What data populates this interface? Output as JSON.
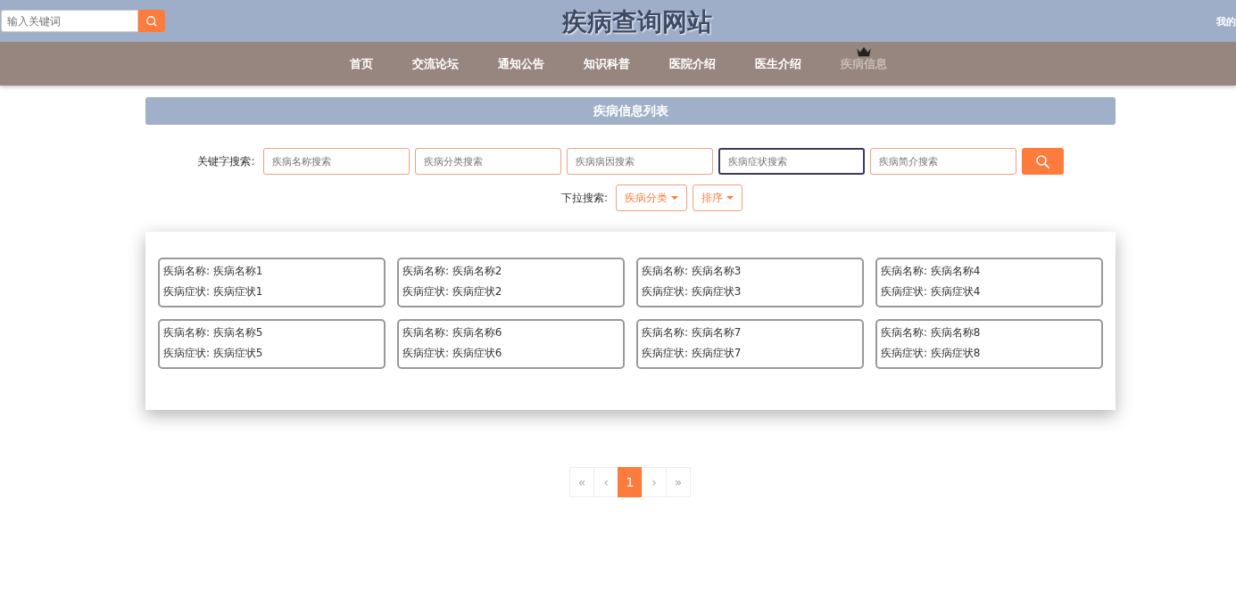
{
  "header": {
    "search": {
      "placeholder": "输入关键词"
    },
    "title": "疾病查询网站",
    "user_link": "我的"
  },
  "nav": [
    {
      "label": "首页",
      "selected": false
    },
    {
      "label": "交流论坛",
      "selected": false
    },
    {
      "label": "通知公告",
      "selected": false
    },
    {
      "label": "知识科普",
      "selected": false
    },
    {
      "label": "医院介绍",
      "selected": false
    },
    {
      "label": "医生介绍",
      "selected": false
    },
    {
      "label": "疾病信息",
      "selected": true
    }
  ],
  "section_title": "疾病信息列表",
  "keyword_search": {
    "label": "关键字搜索:",
    "fields": [
      {
        "placeholder": "疾病名称搜索",
        "focused": false
      },
      {
        "placeholder": "疾病分类搜索",
        "focused": false
      },
      {
        "placeholder": "疾病病因搜索",
        "focused": false
      },
      {
        "placeholder": "疾病症状搜索",
        "focused": true
      },
      {
        "placeholder": "疾病简介搜索",
        "focused": false
      }
    ]
  },
  "dropdown_search": {
    "label": "下拉搜索:",
    "dropdowns": [
      "疾病分类",
      "排序"
    ]
  },
  "cards": [
    {
      "lines": [
        "疾病名称: 疾病名称1",
        "疾病症状: 疾病症状1"
      ]
    },
    {
      "lines": [
        "疾病名称: 疾病名称2",
        "疾病症状: 疾病症状2"
      ]
    },
    {
      "lines": [
        "疾病名称: 疾病名称3",
        "疾病症状: 疾病症状3"
      ]
    },
    {
      "lines": [
        "疾病名称: 疾病名称4",
        "疾病症状: 疾病症状4"
      ]
    },
    {
      "lines": [
        "疾病名称: 疾病名称5",
        "疾病症状: 疾病症状5"
      ]
    },
    {
      "lines": [
        "疾病名称: 疾病名称6",
        "疾病症状: 疾病症状6"
      ]
    },
    {
      "lines": [
        "疾病名称: 疾病名称7",
        "疾病症状: 疾病症状7"
      ]
    },
    {
      "lines": [
        "疾病名称: 疾病名称8",
        "疾病症状: 疾病症状8"
      ]
    }
  ],
  "pagination": [
    {
      "label": "«",
      "selected": false
    },
    {
      "label": "‹",
      "selected": false
    },
    {
      "label": "1",
      "selected": true
    },
    {
      "label": "›",
      "selected": false
    },
    {
      "label": "»",
      "selected": false
    }
  ]
}
